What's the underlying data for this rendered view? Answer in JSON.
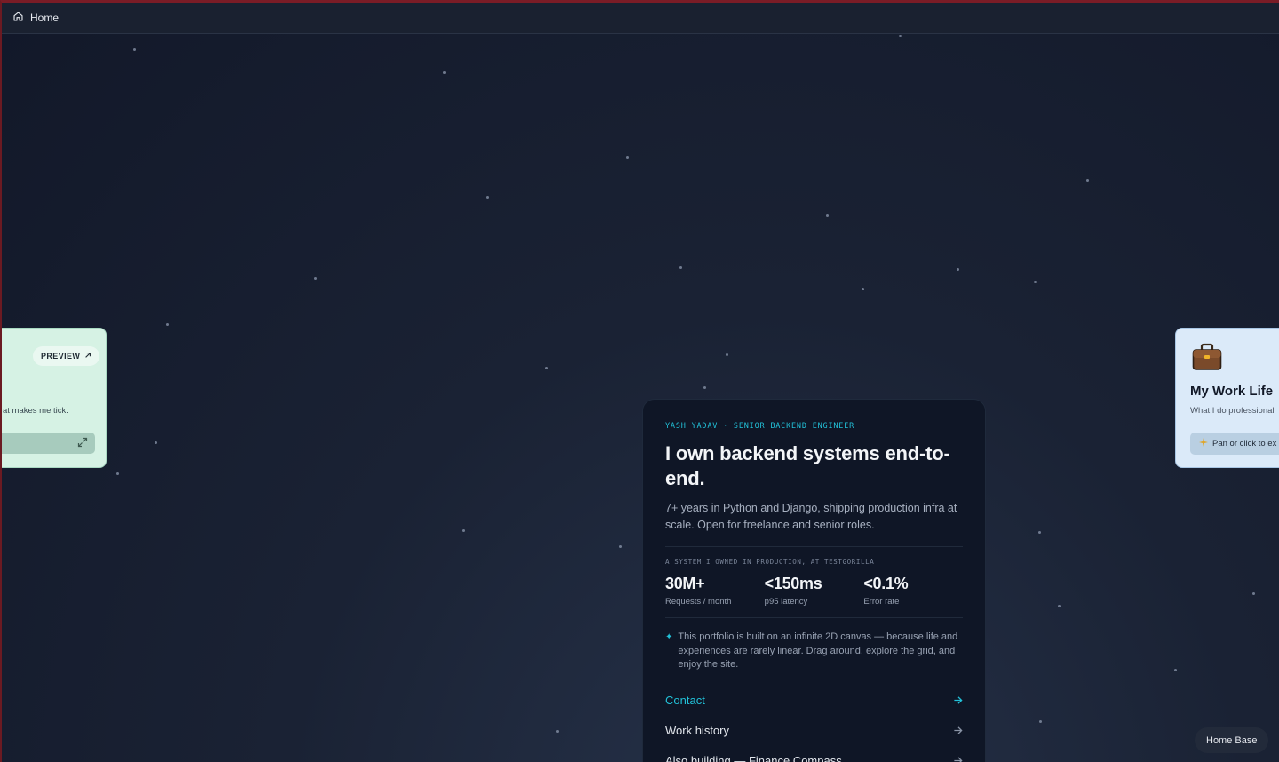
{
  "topbar": {
    "home_label": "Home"
  },
  "left_card": {
    "preview_label": "PREVIEW",
    "text": "at makes me tick."
  },
  "right_card": {
    "title": "My Work Life",
    "subtitle": "What I do professionall",
    "pan_label": "Pan or click to ex"
  },
  "main_card": {
    "eyebrow": "YASH YADAV · SENIOR BACKEND ENGINEER",
    "headline": "I own backend systems end-to-end.",
    "lede": "7+ years in Python and Django, shipping production infra at scale. Open for freelance and senior roles.",
    "caption": "A SYSTEM I OWNED IN PRODUCTION, AT TESTGORILLA",
    "stats": [
      {
        "value": "30M+",
        "label": "Requests / month"
      },
      {
        "value": "<150ms",
        "label": "p95 latency"
      },
      {
        "value": "<0.1%",
        "label": "Error rate"
      }
    ],
    "note": "This portfolio is built on an infinite 2D canvas — because life and experiences are rarely linear. Drag around, explore the grid, and enjoy the site.",
    "links": [
      {
        "label": "Contact"
      },
      {
        "label": "Work history"
      },
      {
        "label": "Also building — Finance Compass"
      }
    ]
  },
  "home_base_label": "Home Base",
  "colors": {
    "accent": "#22c1d8",
    "card_bg": "#0f1626",
    "left_card_bg": "#d6f2e4",
    "right_card_bg": "#dbeaf9"
  },
  "icons": {
    "home": "home-icon",
    "preview": "arrow-up-right-icon",
    "expand": "expand-icon",
    "work": "briefcase-icon",
    "pan": "sparkle-icon",
    "note": "sparkle-icon",
    "links": "arrow-right-icon"
  }
}
